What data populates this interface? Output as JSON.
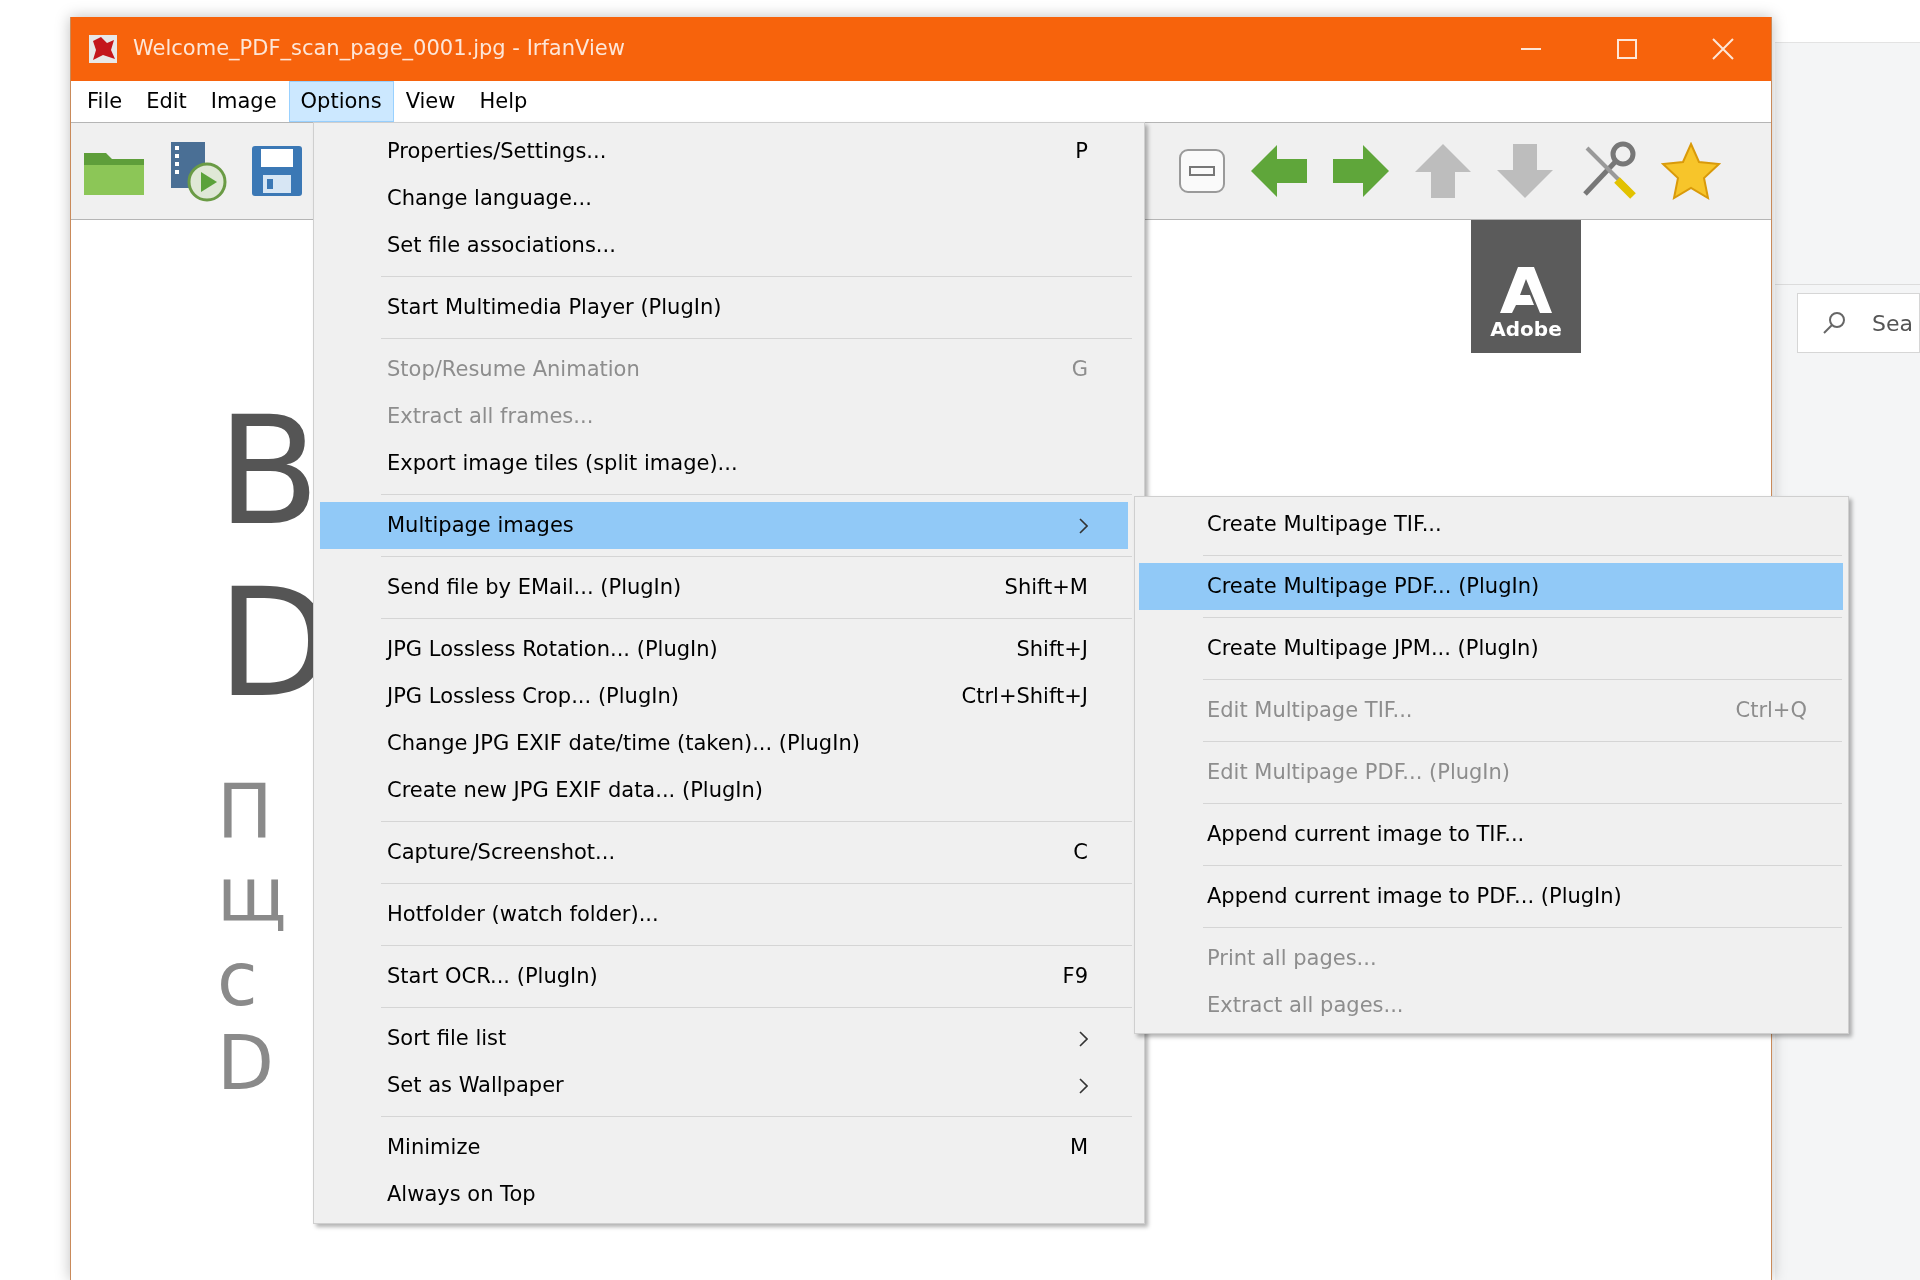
{
  "window": {
    "title": "Welcome_PDF_scan_page_0001.jpg - IrfanView"
  },
  "menubar": [
    {
      "label": "File",
      "selected": false
    },
    {
      "label": "Edit",
      "selected": false
    },
    {
      "label": "Image",
      "selected": false
    },
    {
      "label": "Options",
      "selected": true
    },
    {
      "label": "View",
      "selected": false
    },
    {
      "label": "Help",
      "selected": false
    }
  ],
  "document": {
    "logo_text": "Adobe",
    "fragments": [
      {
        "kind": "heading",
        "text": "B"
      },
      {
        "kind": "heading",
        "text": "D"
      },
      {
        "kind": "body",
        "text": "П"
      },
      {
        "kind": "body",
        "text": "щ"
      },
      {
        "kind": "body",
        "text": "с"
      },
      {
        "kind": "body",
        "text": "D"
      }
    ]
  },
  "options_menu": {
    "sections": [
      [
        {
          "label": "Properties/Settings...",
          "shortcut": "P",
          "kind": "command",
          "disabled": false,
          "selected": false
        },
        {
          "label": "Change language...",
          "kind": "command",
          "disabled": false,
          "selected": false
        },
        {
          "label": "Set file associations...",
          "kind": "command",
          "disabled": false,
          "selected": false
        }
      ],
      [
        {
          "label": "Start Multimedia Player (PlugIn)",
          "kind": "command",
          "disabled": false,
          "selected": false
        }
      ],
      [
        {
          "label": "Stop/Resume Animation",
          "shortcut": "G",
          "kind": "command",
          "disabled": true,
          "selected": false
        },
        {
          "label": "Extract all frames...",
          "kind": "command",
          "disabled": true,
          "selected": false
        },
        {
          "label": "Export image tiles (split image)...",
          "kind": "command",
          "disabled": false,
          "selected": false
        }
      ],
      [
        {
          "label": "Multipage images",
          "kind": "submenu",
          "disabled": false,
          "selected": true
        }
      ],
      [
        {
          "label": "Send file by EMail... (PlugIn)",
          "shortcut": "Shift+M",
          "kind": "command",
          "disabled": false,
          "selected": false
        }
      ],
      [
        {
          "label": "JPG Lossless Rotation... (PlugIn)",
          "shortcut": "Shift+J",
          "kind": "command",
          "disabled": false,
          "selected": false
        },
        {
          "label": "JPG Lossless Crop... (PlugIn)",
          "shortcut": "Ctrl+Shift+J",
          "kind": "command",
          "disabled": false,
          "selected": false
        },
        {
          "label": "Change JPG EXIF date/time (taken)... (PlugIn)",
          "kind": "command",
          "disabled": false,
          "selected": false
        },
        {
          "label": "Create new JPG EXIF data... (PlugIn)",
          "kind": "command",
          "disabled": false,
          "selected": false
        }
      ],
      [
        {
          "label": "Capture/Screenshot...",
          "shortcut": "C",
          "kind": "command",
          "disabled": false,
          "selected": false
        }
      ],
      [
        {
          "label": "Hotfolder (watch folder)...",
          "kind": "command",
          "disabled": false,
          "selected": false
        }
      ],
      [
        {
          "label": "Start OCR... (PlugIn)",
          "shortcut": "F9",
          "kind": "command",
          "disabled": false,
          "selected": false
        }
      ],
      [
        {
          "label": "Sort file list",
          "kind": "submenu",
          "disabled": false,
          "selected": false
        },
        {
          "label": "Set as Wallpaper",
          "kind": "submenu",
          "disabled": false,
          "selected": false
        }
      ],
      [
        {
          "label": "Minimize",
          "shortcut": "M",
          "kind": "command",
          "disabled": false,
          "selected": false
        },
        {
          "label": "Always on Top",
          "kind": "command",
          "disabled": false,
          "selected": false
        }
      ]
    ]
  },
  "multipage_submenu": {
    "sections": [
      [
        {
          "label": "Create Multipage TIF...",
          "disabled": false,
          "selected": false
        }
      ],
      [
        {
          "label": "Create Multipage PDF... (PlugIn)",
          "disabled": false,
          "selected": true
        }
      ],
      [
        {
          "label": "Create Multipage JPM... (PlugIn)",
          "disabled": false,
          "selected": false
        }
      ],
      [
        {
          "label": "Edit Multipage TIF...",
          "shortcut": "Ctrl+Q",
          "disabled": true,
          "selected": false
        }
      ],
      [
        {
          "label": "Edit Multipage PDF... (PlugIn)",
          "disabled": true,
          "selected": false
        }
      ],
      [
        {
          "label": "Append current image to TIF...",
          "disabled": false,
          "selected": false
        }
      ],
      [
        {
          "label": "Append current image to PDF... (PlugIn)",
          "disabled": false,
          "selected": false
        }
      ],
      [
        {
          "label": "Print all pages...",
          "disabled": true,
          "selected": false
        },
        {
          "label": "Extract all pages...",
          "disabled": true,
          "selected": false
        }
      ]
    ]
  },
  "search": {
    "placeholder": "Sea"
  }
}
